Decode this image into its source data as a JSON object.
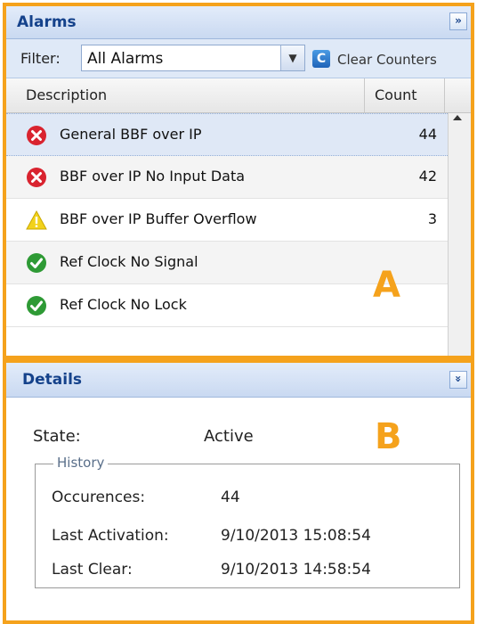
{
  "alarms_panel": {
    "title": "Alarms",
    "collapse_glyph": "»",
    "filter_label": "Filter:",
    "filter_value": "All Alarms",
    "clear_counters_label": "Clear Counters",
    "columns": {
      "description": "Description",
      "count": "Count"
    },
    "rows": [
      {
        "icon": "error-icon",
        "description": "General BBF over IP",
        "count": "44"
      },
      {
        "icon": "error-icon",
        "description": "BBF over IP No Input Data",
        "count": "42"
      },
      {
        "icon": "warning-icon",
        "description": "BBF over IP Buffer Overflow",
        "count": "3"
      },
      {
        "icon": "ok-icon",
        "description": "Ref Clock No Signal",
        "count": ""
      },
      {
        "icon": "ok-icon",
        "description": "Ref Clock No Lock",
        "count": ""
      }
    ],
    "annotation": "A"
  },
  "details_panel": {
    "title": "Details",
    "expand_glyph": "»",
    "state_label": "State:",
    "state_value": "Active",
    "annotation": "B",
    "history": {
      "legend": "History",
      "items": [
        {
          "label": "Occurences:",
          "value": "44"
        },
        {
          "label": "Last Activation:",
          "value": "9/10/2013 15:08:54"
        },
        {
          "label": "Last Clear:",
          "value": "9/10/2013 14:58:54"
        }
      ]
    }
  },
  "colors": {
    "annotation_orange": "#f5a21c",
    "title_blue": "#15428b",
    "error_red": "#d9232f",
    "warning_yellow": "#f2d21b",
    "ok_green": "#2e9a35"
  }
}
